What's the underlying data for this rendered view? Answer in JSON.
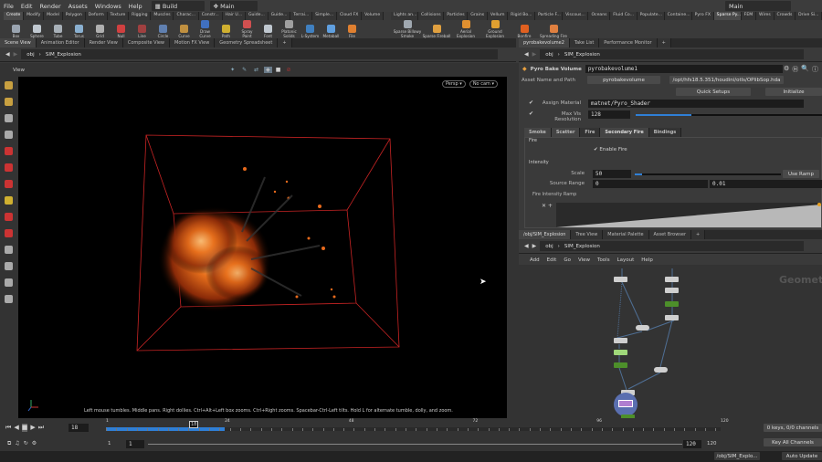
{
  "menu": {
    "items": [
      "File",
      "Edit",
      "Render",
      "Assets",
      "Windows",
      "Help"
    ],
    "desktop": "Build",
    "main_left": "Main",
    "main_right": "Main"
  },
  "shelf_tabs_left": [
    "Create",
    "Modify",
    "Model",
    "Polygon",
    "Deform",
    "Texture",
    "Rigging",
    "Muscles",
    "Charac...",
    "Constr...",
    "Hair U...",
    "Guide...",
    "Guide...",
    "Terrai...",
    "Simple...",
    "Cloud FX",
    "Volume"
  ],
  "shelf_tabs_right": [
    "Lights an...",
    "Collisions",
    "Particles",
    "Grains",
    "Vellum",
    "Rigid Bo...",
    "Particle F...",
    "Viscous...",
    "Oceans",
    "Fluid Co...",
    "Populate...",
    "Containe...",
    "Pyro FX",
    "Sparse Py...",
    "FEM",
    "Wires",
    "Crowds",
    "Drive Si..."
  ],
  "tools_left": [
    {
      "label": "Box",
      "color": "#9aa4b0"
    },
    {
      "label": "Sphere",
      "color": "#c0c8d0"
    },
    {
      "label": "Tube",
      "color": "#a8b0b8"
    },
    {
      "label": "Torus",
      "color": "#8ab0d0"
    },
    {
      "label": "Grid",
      "color": "#b0b0b0"
    },
    {
      "label": "Null",
      "color": "#d04040"
    },
    {
      "label": "Line",
      "color": "#a04040"
    },
    {
      "label": "Circle",
      "color": "#6080b0"
    },
    {
      "label": "Curve",
      "color": "#c09040"
    },
    {
      "label": "Draw Curve",
      "color": "#4070c0"
    },
    {
      "label": "Path",
      "color": "#d0b030"
    },
    {
      "label": "Spray Paint",
      "color": "#d05050"
    },
    {
      "label": "Font",
      "color": "#c0c8d0"
    },
    {
      "label": "Platonic Solids",
      "color": "#a0a0a0"
    },
    {
      "label": "L-System",
      "color": "#4080c0"
    },
    {
      "label": "Metaball",
      "color": "#60a0e0"
    },
    {
      "label": "File",
      "color": "#e08030"
    }
  ],
  "tools_right": [
    {
      "label": "Sparse Billowy Smoke",
      "color": "#a0a8b0"
    },
    {
      "label": "Sparse Fireball",
      "color": "#e0a040"
    },
    {
      "label": "Aerial Explosion",
      "color": "#e09030"
    },
    {
      "label": "Ground Explosion",
      "color": "#e0a030"
    },
    {
      "label": "Bonfire",
      "color": "#e06020"
    },
    {
      "label": "Spreading Fire",
      "color": "#e08040"
    }
  ],
  "left_pane": {
    "tabs": [
      "Scene View",
      "Animation Editor",
      "Render View",
      "Composite View",
      "Motion FX View",
      "Geometry Spreadsheet"
    ],
    "path": [
      "obj",
      "SIM_Explosion"
    ],
    "viewport_label": "View",
    "persp": "Persp",
    "cam": "No cam",
    "hint": "Left mouse tumbles. Middle pans. Right dollies. Ctrl+Alt+Left box zooms. Ctrl+Right zooms. Spacebar-Ctrl-Left tilts. Hold L for alternate tumble, dolly, and zoom."
  },
  "param_pane": {
    "tabs": [
      "pyrobakevolume2",
      "Take List",
      "Performance Monitor"
    ],
    "path": [
      "obj",
      "SIM_Explosion"
    ],
    "node_type": "Pyro Bake Volume",
    "node_name": "pyrobakevolume1",
    "asset_label": "Asset Name and Path",
    "asset_name": "pyrobakevolume",
    "asset_path": "/opt/hfs18.5.351/houdini/otls/OPlibSop.hda",
    "quick_setups": "Quick Setups",
    "initialize": "Initialize",
    "assign_material_label": "Assign Material",
    "assign_material": "matnet/Pyro_Shader",
    "max_vis_label": "Max Vis Resolution",
    "max_vis": "128",
    "max_vis_fraction": 0.3,
    "subtabs": [
      "Smoke",
      "Scatter",
      "Fire",
      "Secondary Fire",
      "Bindings"
    ],
    "active_subtab": "Secondary Fire",
    "fire_group": "Fire",
    "enable_fire": "Enable Fire",
    "intensity_group": "Intensity",
    "scale_label": "Scale",
    "scale": "50",
    "scale_fraction": 0.05,
    "use_ramp": "Use Ramp",
    "source_range_label": "Source Range",
    "source_min": "0",
    "source_max": "0.01",
    "ramp_label": "Fire Intensity Ramp"
  },
  "network_pane": {
    "tabs": [
      "/obj/SIM_Explosion",
      "Tree View",
      "Material Palette",
      "Asset Browser"
    ],
    "path": [
      "obj",
      "SIM_Explosion"
    ],
    "menu": [
      "Add",
      "Edit",
      "Go",
      "View",
      "Tools",
      "Layout",
      "Help"
    ],
    "watermark": "Geometry"
  },
  "timeline": {
    "frame": "18",
    "current_frame": 18,
    "start": 1,
    "end": 120,
    "ticks": [
      "1",
      "24",
      "48",
      "72",
      "96",
      "120"
    ],
    "range_start": "1",
    "range_start2": "1",
    "range_end": "120",
    "range_end2": "120",
    "keys": "0 keys, 0/0 channels",
    "key_all": "Key All Channels"
  },
  "status": {
    "path": "/obj/SIM_Explo...",
    "auto_update": "Auto Update"
  },
  "colors": {
    "accent": "#2f7fd6",
    "box": "#d02828",
    "fire": "#e86a1c"
  }
}
